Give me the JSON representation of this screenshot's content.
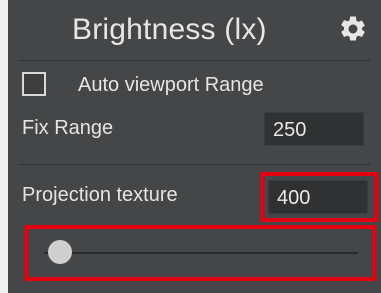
{
  "panel": {
    "title": "Brightness (lx)",
    "settings_icon": "gear-icon",
    "auto_viewport": {
      "label": "Auto viewport Range",
      "checked": false
    },
    "fix_range": {
      "label": "Fix Range",
      "value": "250"
    },
    "projection_texture": {
      "label": "Projection texture",
      "value": "400"
    },
    "slider": {
      "level": 0.05
    }
  },
  "colors": {
    "panel_bg": "#444648",
    "highlight": "#e1000f",
    "field_bg": "#2f3133"
  }
}
